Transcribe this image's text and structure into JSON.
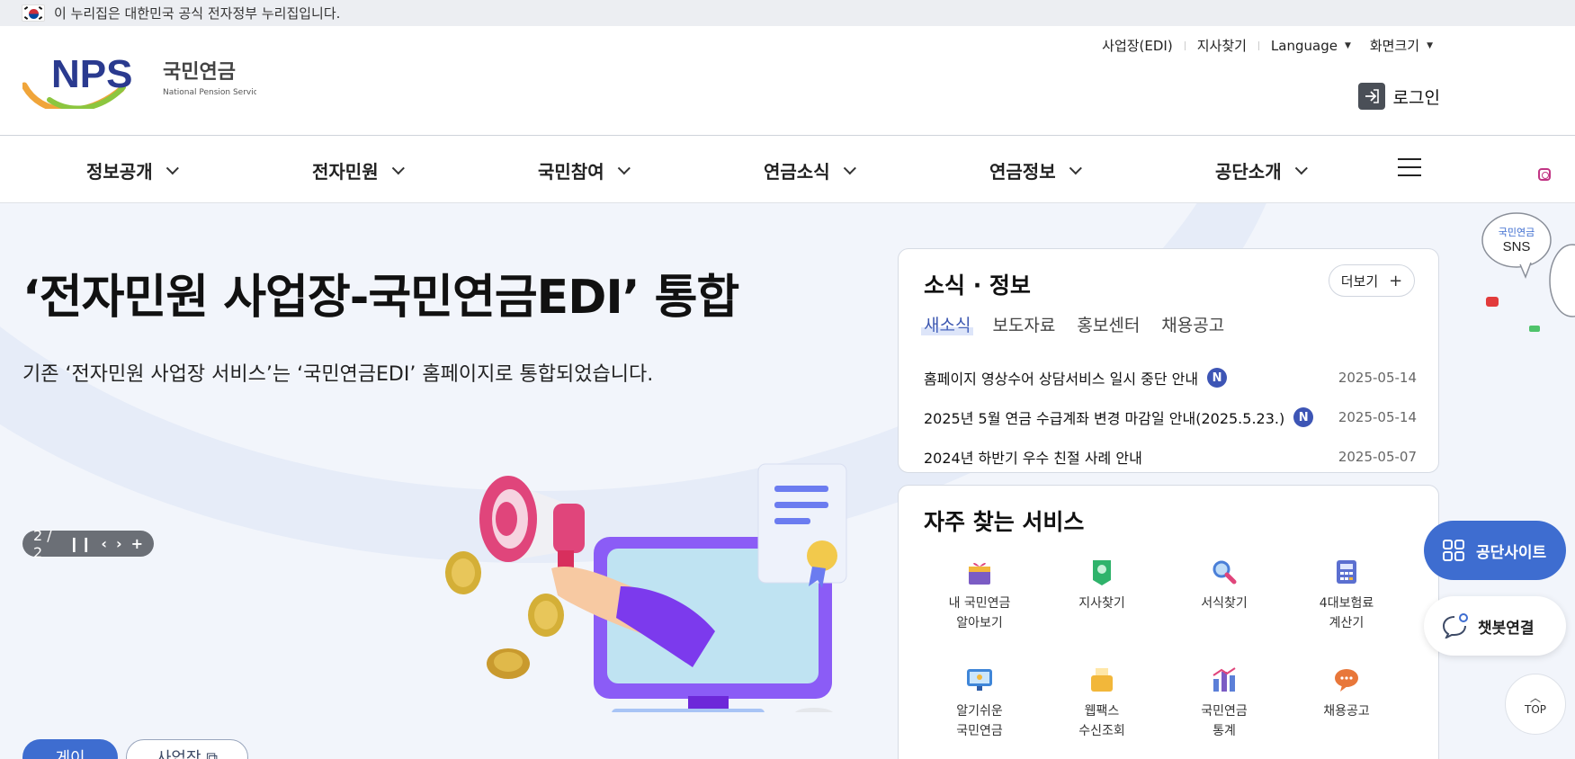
{
  "gov_banner": {
    "text": "이 누리집은 대한민국 공식 전자정부 누리집입니다."
  },
  "logo": {
    "mark": "NPS",
    "name_ko": "국민연금",
    "name_en": "National Pension Service"
  },
  "utility_nav": [
    {
      "label": "사업장(EDI)",
      "dropdown": false
    },
    {
      "label": "지사찾기",
      "dropdown": false
    },
    {
      "label": "Language",
      "dropdown": true
    },
    {
      "label": "화면크기",
      "dropdown": true
    }
  ],
  "login": {
    "label": "로그인"
  },
  "gnb": [
    "정보공개",
    "전자민원",
    "국민참여",
    "연금소식",
    "연금정보",
    "공단소개"
  ],
  "hero": {
    "title": "‘전자민원 사업장-국민연금EDI’ 통합",
    "desc": "기존 ‘전자민원 사업장 서비스’는 ‘국민연금EDI’ 홈페이지로 통합되었습니다.",
    "pager": "2 / 2",
    "btn_primary": "게이",
    "btn_secondary": "사업장 ⧉"
  },
  "news": {
    "title": "소식 · 정보",
    "more": "더보기",
    "tabs": [
      "새소식",
      "보도자료",
      "홍보센터",
      "채용공고"
    ],
    "active_tab": 0,
    "items": [
      {
        "title": "홈페이지 영상수어 상담서비스 일시 중단 안내",
        "badge": "N",
        "date": "2025-05-14"
      },
      {
        "title": "2025년 5월 연금 수급계좌 변경 마감일 안내(2025.5.23.)",
        "badge": "N",
        "date": "2025-05-14"
      },
      {
        "title": "2024년 하반기 우수 친절 사례 안내",
        "badge": "",
        "date": "2025-05-07"
      }
    ]
  },
  "services": {
    "title": "자주 찾는 서비스",
    "items": [
      {
        "label1": "내 국민연금",
        "label2": "알아보기",
        "icon": "gift-icon",
        "color": "#7b5cc4"
      },
      {
        "label1": "지사찾기",
        "label2": "",
        "icon": "map-pin-icon",
        "color": "#2fb36b"
      },
      {
        "label1": "서식찾기",
        "label2": "",
        "icon": "magnifier-icon",
        "color": "#4a7fd8"
      },
      {
        "label1": "4대보험료",
        "label2": "계산기",
        "icon": "calculator-icon",
        "color": "#5b6fd0"
      },
      {
        "label1": "알기쉬운",
        "label2": "국민연금",
        "icon": "monitor-icon",
        "color": "#3f86d8"
      },
      {
        "label1": "웹팩스",
        "label2": "수신조회",
        "icon": "fax-icon",
        "color": "#f2b73a"
      },
      {
        "label1": "국민연금",
        "label2": "통계",
        "icon": "chart-icon",
        "color": "#5b7fd8"
      },
      {
        "label1": "채용공고",
        "label2": "",
        "icon": "speech-bubble-icon",
        "color": "#e8773a"
      }
    ]
  },
  "side": {
    "sns_label1": "국민연금",
    "sns_label2": "SNS",
    "site_btn": "공단사이트",
    "bot_btn": "챗봇연결",
    "top_btn": "TOP"
  },
  "colors": {
    "primary": "#3e6dd0",
    "badge": "#3d55b5",
    "hero_bg": "#f2f5fb"
  }
}
